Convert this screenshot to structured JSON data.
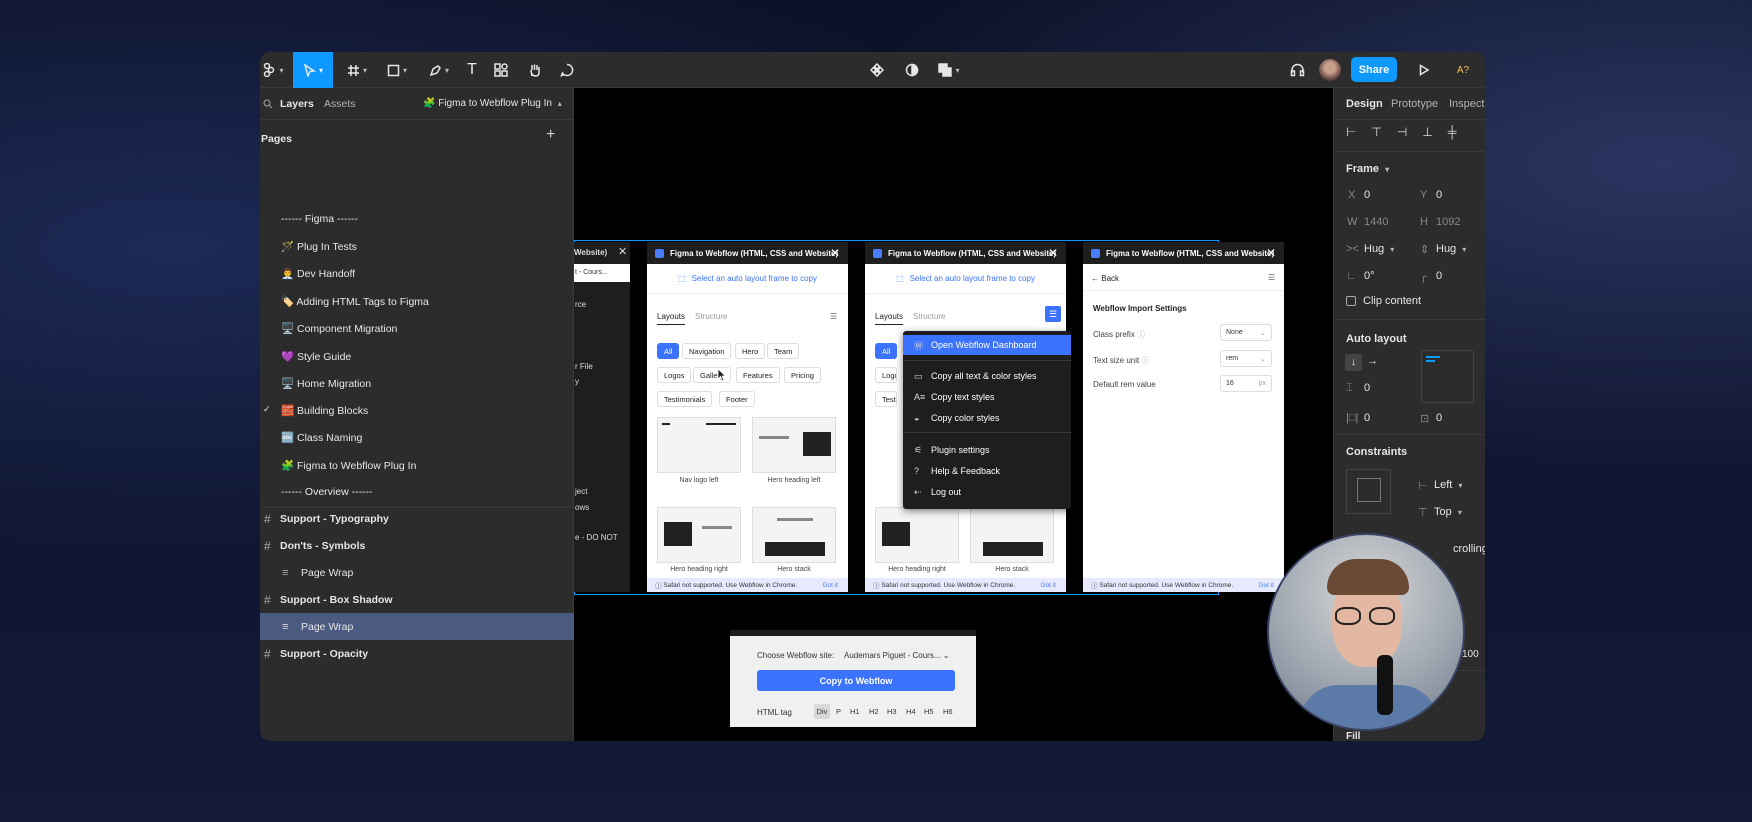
{
  "toolbar": {
    "right_label": "A?",
    "share_label": "Share"
  },
  "left_panel": {
    "tabs": {
      "layers": "Layers",
      "assets": "Assets"
    },
    "plugin_page": "🧩 Figma to Webflow Plug In",
    "pages_title": "Pages",
    "pages": [
      "------ Figma ------",
      "🪄 Plug In Tests",
      "👨‍💼 Dev Handoff",
      "🏷️ Adding HTML Tags to Figma",
      "🖥️ Component Migration",
      "💜 Style Guide",
      "🖥️ Home Migration",
      "🧱 Building Blocks",
      "🔤 Class Naming",
      "🧩 Figma to Webflow Plug In",
      "------ Overview ------"
    ],
    "layers": [
      {
        "label": "Support - Typography",
        "type": "frame"
      },
      {
        "label": "Don'ts - Symbols",
        "type": "frame"
      },
      {
        "label": "Page Wrap",
        "type": "child"
      },
      {
        "label": "Support - Box Shadow",
        "type": "frame"
      },
      {
        "label": "Page Wrap",
        "type": "child-selected"
      },
      {
        "label": "Support - Opacity",
        "type": "frame"
      }
    ]
  },
  "right_panel": {
    "tabs": {
      "design": "Design",
      "prototype": "Prototype",
      "inspect": "Inspect"
    },
    "frame_title": "Frame",
    "x_label": "X",
    "x_value": "0",
    "y_label": "Y",
    "y_value": "0",
    "w_label": "W",
    "w_value": "1440",
    "h_label": "H",
    "h_value": "1092",
    "hug_w": "Hug",
    "hug_h": "Hug",
    "rotation": "0°",
    "radius": "0",
    "clip_content": "Clip content",
    "auto_layout_title": "Auto layout",
    "gap": "0",
    "padding_h": "0",
    "padding_v": "0",
    "constraints_title": "Constraints",
    "constraint_h": "Left",
    "constraint_v": "Top",
    "scrolling_partial": "crolling",
    "opacity_partial": "100",
    "fill_title": "Fill"
  },
  "canvas": {
    "partial_window": {
      "title_partial": "Website)",
      "dropdown_partial": "t - Cours...",
      "lines": [
        "rce",
        "r File",
        "y",
        "ject",
        "ows",
        "e - DO NOT"
      ]
    },
    "plugin_title": "Figma to Webflow (HTML, CSS and Website)",
    "select_prompt": "Select an auto layout frame to copy",
    "tab_layouts": "Layouts",
    "tab_structure": "Structure",
    "filters": [
      "All",
      "Navigation",
      "Hero",
      "Team",
      "Logos",
      "Gallery",
      "Features",
      "Pricing",
      "Testimonials",
      "Footer"
    ],
    "thumbs": [
      "Nav logo left",
      "Hero heading left",
      "Hero heading right",
      "Hero stack"
    ],
    "banner_text": "Safari not supported. Use Webflow in Chrome.",
    "banner_got": "Got it",
    "menu": {
      "primary": "Open Webflow Dashboard",
      "items": [
        "Copy all text & color styles",
        "Copy text styles",
        "Copy color styles",
        "Plugin settings",
        "Help & Feedback",
        "Log out"
      ]
    },
    "settings": {
      "back": "Back",
      "title": "Webflow Import Settings",
      "class_prefix_label": "Class prefix",
      "class_prefix_value": "None",
      "text_size_label": "Text size unit",
      "text_size_value": "rem",
      "rem_label": "Default rem value",
      "rem_value": "16",
      "rem_unit": "px"
    },
    "bottom_dialog": {
      "site_label": "Choose Webflow site:",
      "site_value": "Audemars Piguet - Cours...",
      "copy_button": "Copy to Webflow",
      "html_tag_label": "HTML tag",
      "tags": [
        "Div",
        "P",
        "H1",
        "H2",
        "H3",
        "H4",
        "H5",
        "H6"
      ]
    }
  }
}
